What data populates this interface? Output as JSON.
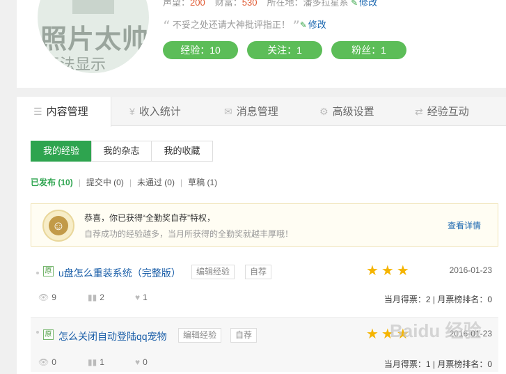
{
  "profile": {
    "avatar_text": "照片太帅",
    "avatar_text2": "无法显示",
    "reputation_label": "声望：",
    "reputation_value": "200",
    "wealth_label": "财富：",
    "wealth_value": "530",
    "location_label": "所在地：",
    "location_value": "潘多拉星系",
    "edit_label": "修改",
    "motto": "不妥之处还请大神批评指正！",
    "motto_edit_label": "修改",
    "pills": {
      "experience": "经验：10",
      "following": "关注：1",
      "fans": "粉丝：1"
    }
  },
  "main_tabs": [
    {
      "label": "内容管理",
      "icon": "list-icon"
    },
    {
      "label": "收入统计",
      "icon": "yen-icon"
    },
    {
      "label": "消息管理",
      "icon": "mail-icon"
    },
    {
      "label": "高级设置",
      "icon": "gear-icon"
    },
    {
      "label": "经验互动",
      "icon": "swap-icon"
    }
  ],
  "sub_tabs": [
    "我的经验",
    "我的杂志",
    "我的收藏"
  ],
  "filters": {
    "published": "已发布",
    "published_count": "(10)",
    "submitting": "提交中 (0)",
    "rejected": "未通过 (0)",
    "drafts": "草稿 (1)"
  },
  "notice": {
    "title": "恭喜，你已获得“全勤奖自荐”特权，",
    "desc": "自荐成功的经验越多，当月所获得的全勤奖就越丰厚哦！",
    "link": "查看详情",
    "icon": "person-badge-icon"
  },
  "items": [
    {
      "badge": "原",
      "title": "u盘怎么重装系统（完整版）",
      "edit_tag": "编辑经验",
      "self_tag": "自荐",
      "stars": "★★★",
      "rating": 3,
      "date": "2016-01-23",
      "views": "9",
      "votes": "2",
      "likes": "1",
      "rank": "当月得票：2 | 月票榜排名：0"
    },
    {
      "badge": "原",
      "title": "怎么关闭自动登陆qq宠物",
      "edit_tag": "编辑经验",
      "self_tag": "自荐",
      "stars": "★★★",
      "rating": 3,
      "date": "2016-01-23",
      "views": "0",
      "votes": "1",
      "likes": "0",
      "rank": "当月得票：1 | 月票榜排名：0"
    }
  ],
  "watermark": "Baidu 经验",
  "colors": {
    "accent_green": "#2ea44f",
    "pill_green": "#5cbd58",
    "link_blue": "#1a67b0",
    "number_red": "#e0572f",
    "star_gold": "#f5b400"
  }
}
